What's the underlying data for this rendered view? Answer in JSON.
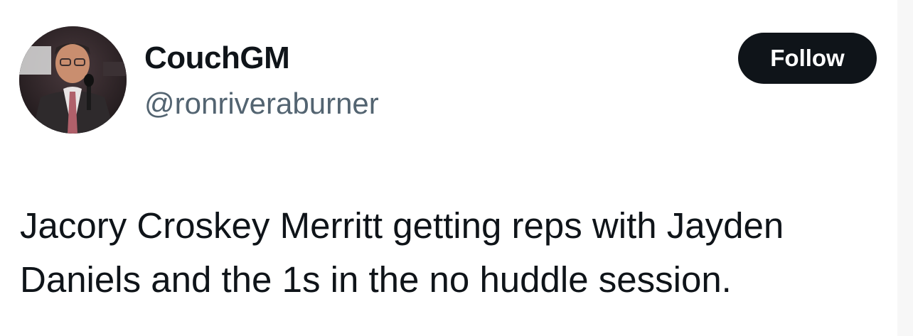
{
  "user": {
    "display_name": "CouchGM",
    "handle": "@ronriveraburner",
    "avatar_icon": "profile-photo-avatar"
  },
  "actions": {
    "follow_label": "Follow"
  },
  "tweet": {
    "text": "Jacory Croskey Merritt getting reps with Jayden Daniels and the 1s in the no huddle session."
  },
  "colors": {
    "text_primary": "#0f1419",
    "text_secondary": "#536471",
    "button_bg": "#0f1419",
    "button_text": "#ffffff"
  }
}
